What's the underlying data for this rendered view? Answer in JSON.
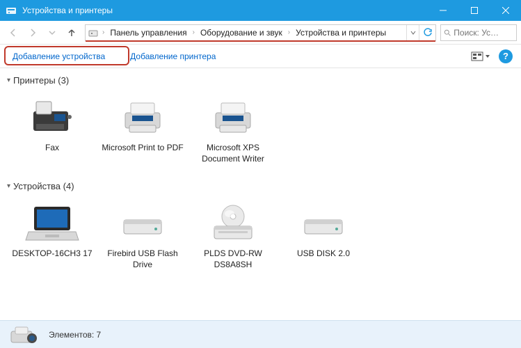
{
  "window": {
    "title": "Устройства и принтеры"
  },
  "breadcrumb": {
    "items": [
      "Панель управления",
      "Оборудование и звук",
      "Устройства и принтеры"
    ]
  },
  "search": {
    "placeholder": "Поиск: Ус…"
  },
  "toolbar": {
    "add_device": "Добавление устройства",
    "add_printer": "Добавление принтера"
  },
  "groups": [
    {
      "title": "Принтеры (3)",
      "items": [
        {
          "label": "Fax",
          "icon": "fax"
        },
        {
          "label": "Microsoft Print to PDF",
          "icon": "printer"
        },
        {
          "label": "Microsoft XPS Document Writer",
          "icon": "printer"
        }
      ]
    },
    {
      "title": "Устройства (4)",
      "items": [
        {
          "label": "DESKTOP-16CH3 17",
          "icon": "laptop"
        },
        {
          "label": "Firebird USB Flash Drive",
          "icon": "drive"
        },
        {
          "label": "PLDS DVD-RW DS8A8SH",
          "icon": "optical"
        },
        {
          "label": "USB DISK 2.0",
          "icon": "drive"
        }
      ]
    }
  ],
  "statusbar": {
    "text": "Элементов: 7"
  }
}
